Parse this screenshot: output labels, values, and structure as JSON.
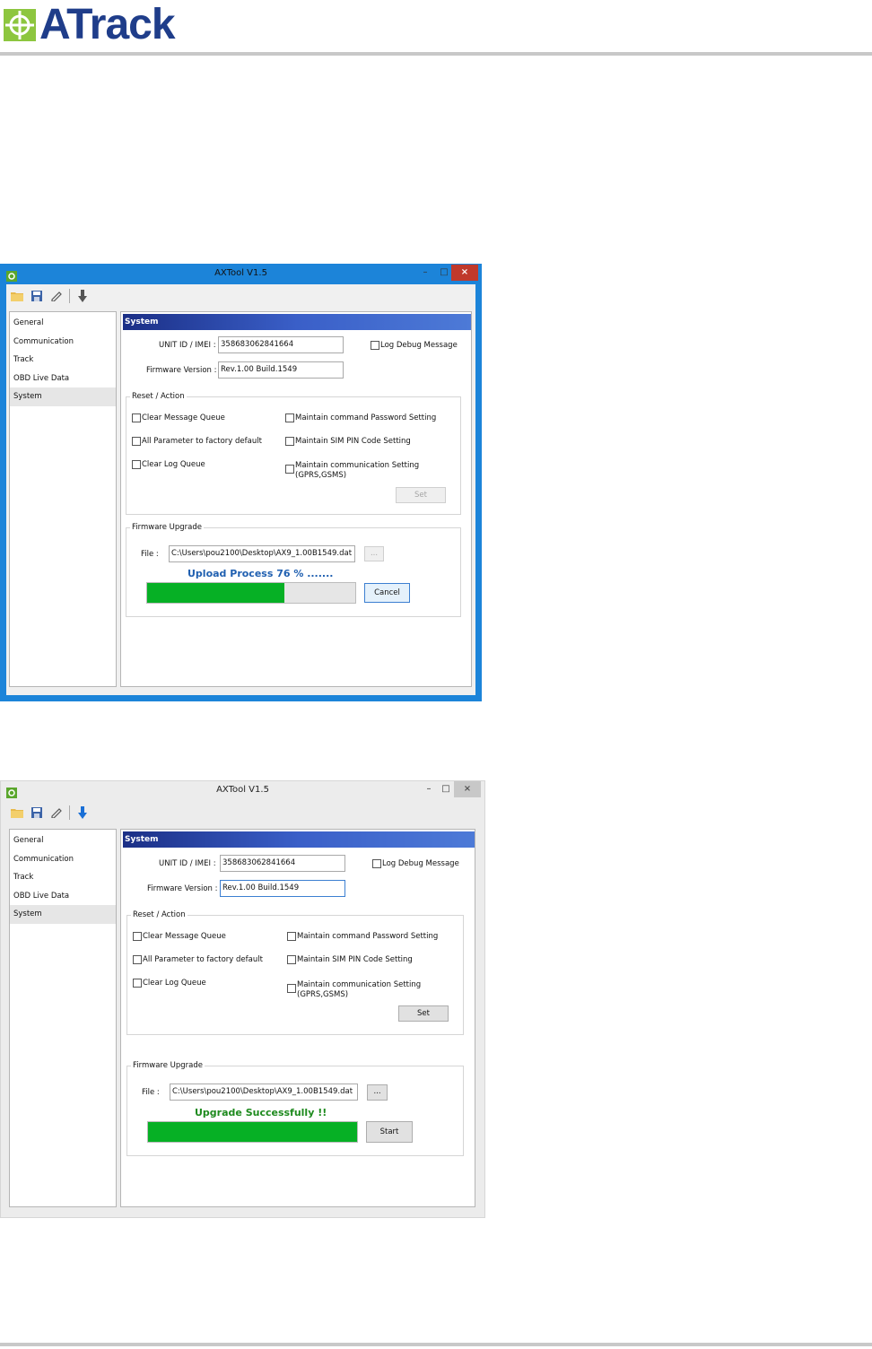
{
  "brand": {
    "name": "ATrack",
    "colors": {
      "mark": "#8dc63f",
      "text": "#1f3d8a"
    }
  },
  "shared": {
    "title": "AXTool V1.5",
    "window_controls": {
      "minimize": "–",
      "maximize": "□",
      "close": "×"
    },
    "toolbar_icons": [
      "open-folder-icon",
      "save-icon",
      "edit-icon",
      "download-arrow-icon"
    ],
    "nav": [
      "General",
      "Communication",
      "Track",
      "OBD Live Data",
      "System"
    ],
    "selected_nav": "System",
    "section_header": "System",
    "unit_id_label": "UNIT ID / IMEI :",
    "unit_id_value": "358683062841664",
    "log_debug_label": "Log Debug Message",
    "fw_version_label": "Firmware Version :",
    "fw_version_value": "Rev.1.00 Build.1549",
    "reset_group_title": "Reset / Action",
    "reset_options": {
      "clear_msg": "Clear Message Queue",
      "all_param": "All Parameter to factory default",
      "clear_log": "Clear Log Queue",
      "maint_pwd": "Maintain command Password Setting",
      "maint_sim": "Maintain SIM PIN Code Setting",
      "maint_comm_1": "Maintain communication Setting",
      "maint_comm_2": "(GPRS,GSMS)"
    },
    "set_button": "Set",
    "fw_group_title": "Firmware Upgrade",
    "file_label": "File :",
    "file_value": "C:\\Users\\pou2100\\Desktop\\AX9_1.00B1549.dat",
    "browse_button": "..."
  },
  "window1": {
    "status_text": "Upload Process 76 % .......",
    "status_color": "#1f5fb0",
    "progress": 0.66,
    "action_button": "Cancel",
    "set_enabled": false
  },
  "window2": {
    "status_text": "Upgrade Successfully !!",
    "status_color": "#1e8a1e",
    "progress": 1.0,
    "action_button": "Start",
    "set_enabled": true
  }
}
